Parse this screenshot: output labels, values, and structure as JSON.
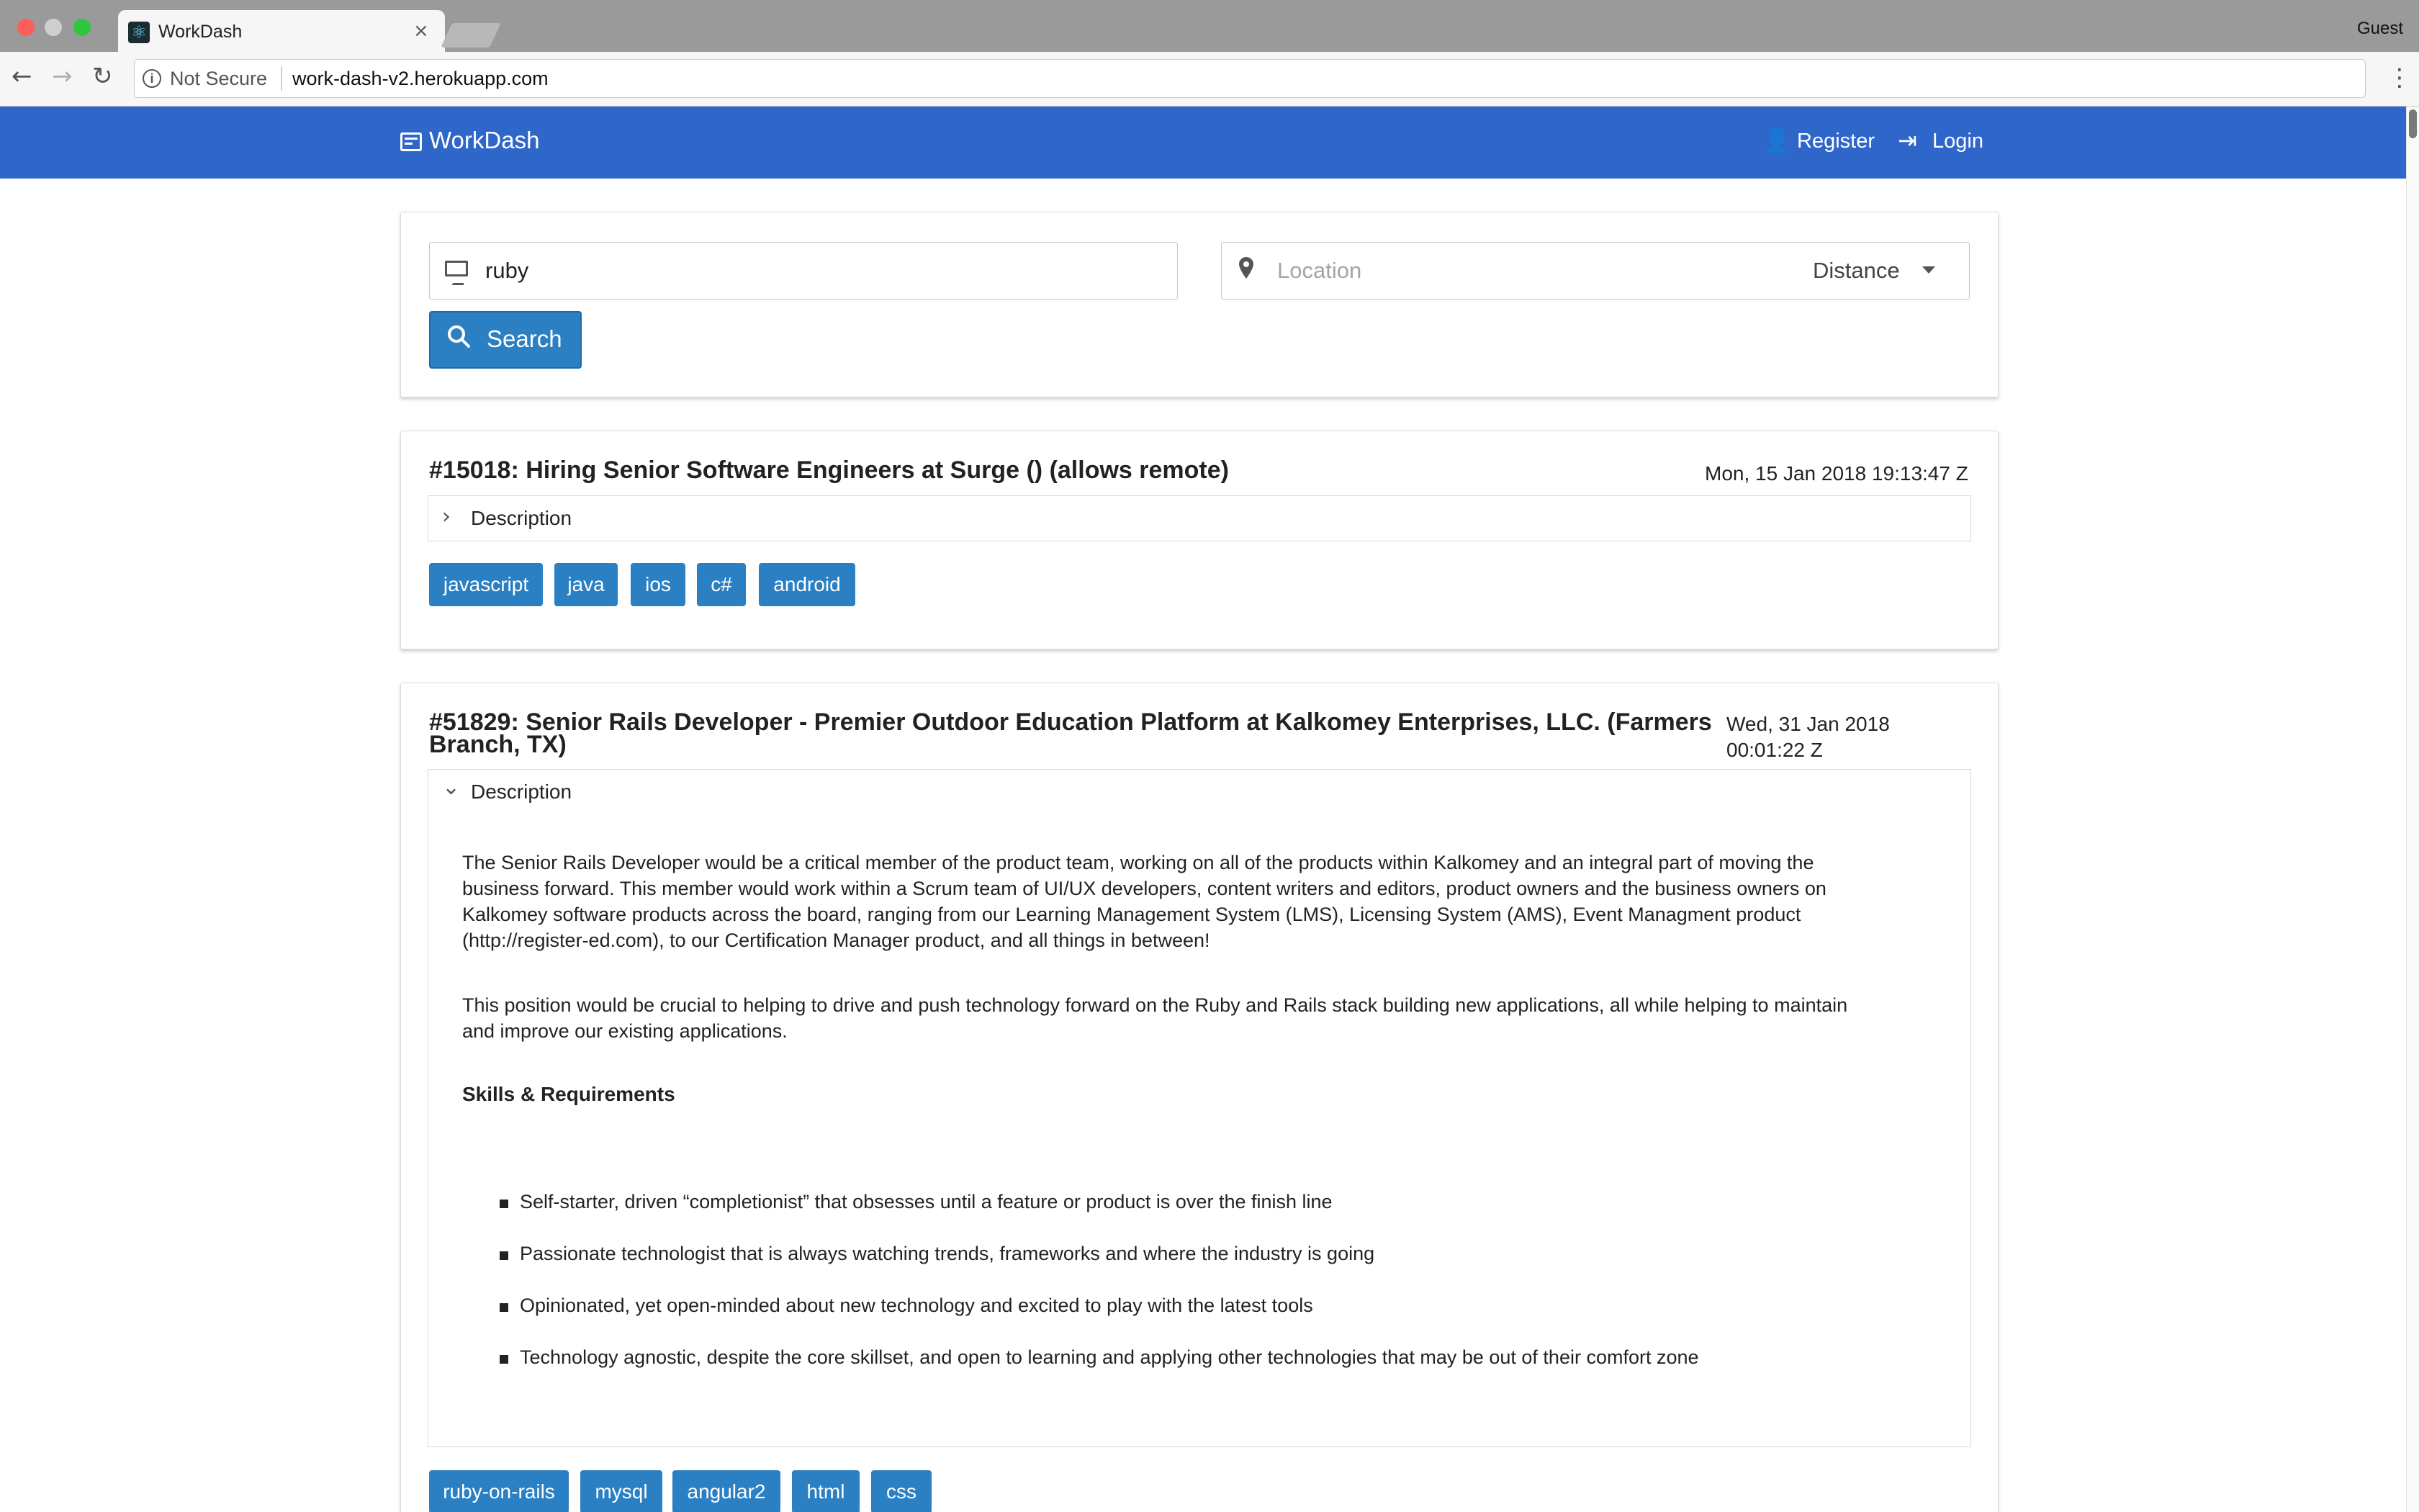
{
  "browser": {
    "tab_title": "WorkDash",
    "tab_close": "×",
    "profile": "Guest",
    "security_label": "Not Secure",
    "url": "work-dash-v2.herokuapp.com",
    "icons": {
      "back": "←",
      "forward": "→",
      "reload": "↻",
      "menu": "⋮",
      "info": "i",
      "favicon": "⚛"
    }
  },
  "appbar": {
    "brand": "WorkDash",
    "register_label": "Register",
    "login_label": "Login",
    "register_icon": "👤",
    "login_icon": "⇥",
    "color": "#2f66ca"
  },
  "search": {
    "keyword_value": "ruby",
    "location_placeholder": "Location",
    "distance_label": "Distance",
    "button_label": "Search",
    "button_icon": "⚲",
    "pin_icon": "⚲"
  },
  "jobs": [
    {
      "title": "#15018: Hiring Senior Software Engineers at Surge () (allows remote)",
      "date": "Mon, 15 Jan 2018 19:13:47 Z",
      "description_label": "Description",
      "expanded": false,
      "chevron": "›",
      "tags": [
        "javascript",
        "java",
        "ios",
        "c#",
        "android"
      ]
    },
    {
      "title_line1": "#51829: Senior Rails Developer - Premier Outdoor Education Platform at Kalkomey Enterprises, LLC. (Farmers",
      "title_line2": "Branch, TX)",
      "date_line1": "Wed, 31 Jan 2018",
      "date_line2": "00:01:22 Z",
      "description_label": "Description",
      "expanded": true,
      "chevron": "⌄",
      "paragraph1": [
        "The Senior Rails Developer would be a critical member of the product team, working on all of the products within Kalkomey and an integral part of moving the",
        "business forward. This member would work within a Scrum team of UI/UX developers, content writers and editors, product owners and the business owners on",
        "Kalkomey software products across the board, ranging from our Learning Management System (LMS), Licensing System (AMS), Event Managment product",
        "(http://register-ed.com), to our Certification Manager product, and all things in between!"
      ],
      "paragraph2": [
        "This position would be crucial to helping to drive and push technology forward on the Ruby and Rails stack building new applications, all while helping to maintain",
        "and improve our existing applications."
      ],
      "skills_heading": "Skills & Requirements",
      "skills": [
        "Self-starter, driven “completionist” that obsesses until a feature or product is over the finish line",
        "Passionate technologist that is always watching trends, frameworks and where the industry is going",
        "Opinionated, yet open-minded about new technology and excited to play with the latest tools",
        "Technology agnostic, despite the core skillset, and open to learning and applying other technologies that may be out of their comfort zone"
      ],
      "tags": [
        "ruby-on-rails",
        "mysql",
        "angular2",
        "html",
        "css"
      ]
    }
  ],
  "colors": {
    "tag": "#2b7fc3",
    "button": "#2b7fc3"
  }
}
